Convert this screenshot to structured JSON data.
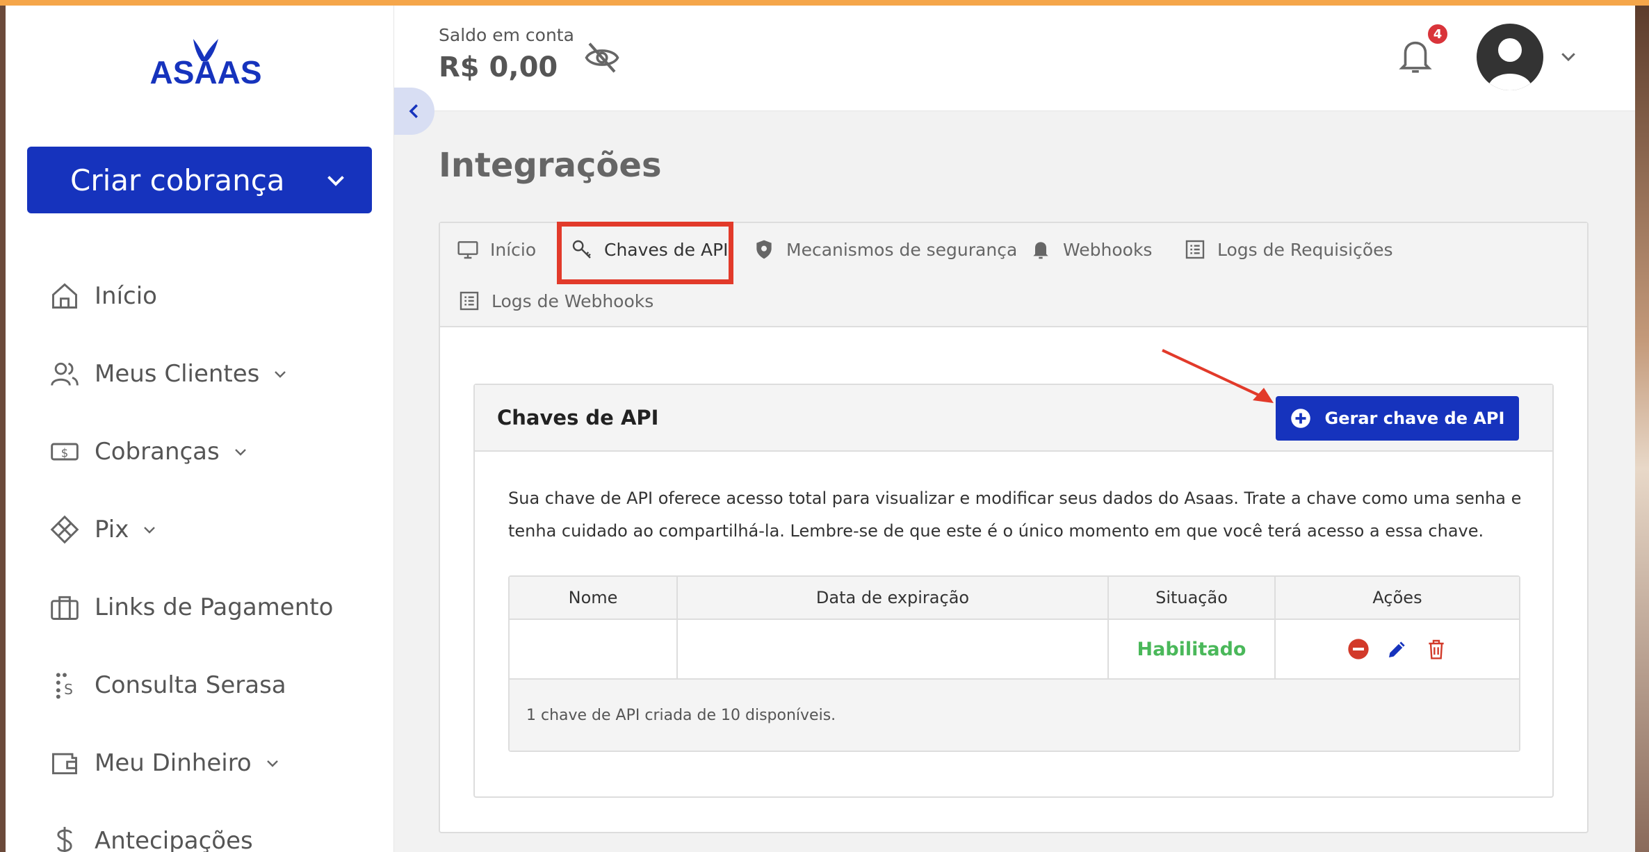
{
  "brand": {
    "logo_text": "ASAAS"
  },
  "sidebar": {
    "cta_label": "Criar cobrança",
    "items": [
      {
        "label": "Início",
        "icon": "home-icon",
        "has_caret": false
      },
      {
        "label": "Meus Clientes",
        "icon": "users-icon",
        "has_caret": true
      },
      {
        "label": "Cobranças",
        "icon": "money-icon",
        "has_caret": true
      },
      {
        "label": "Pix",
        "icon": "pix-icon",
        "has_caret": true
      },
      {
        "label": "Links de Pagamento",
        "icon": "briefcase-icon",
        "has_caret": false
      },
      {
        "label": "Consulta Serasa",
        "icon": "serasa-icon",
        "has_caret": false
      },
      {
        "label": "Meu Dinheiro",
        "icon": "wallet-icon",
        "has_caret": true
      },
      {
        "label": "Antecipações",
        "icon": "dollar-icon",
        "has_caret": false
      }
    ]
  },
  "header": {
    "balance_label": "Saldo em conta",
    "balance_value": "R$ 0,00",
    "notification_count": "4"
  },
  "page": {
    "title": "Integrações"
  },
  "tabs": [
    {
      "label": "Início",
      "icon": "monitor-icon"
    },
    {
      "label": "Chaves de API",
      "icon": "key-icon",
      "active": true
    },
    {
      "label": "Mecanismos de segurança",
      "icon": "shield-icon"
    },
    {
      "label": "Webhooks",
      "icon": "bell-icon"
    },
    {
      "label": "Logs de Requisições",
      "icon": "list-icon"
    },
    {
      "label": "Logs de Webhooks",
      "icon": "list-icon"
    }
  ],
  "card": {
    "title": "Chaves de API",
    "generate_button": "Gerar chave de API",
    "description": "Sua chave de API oferece acesso total para visualizar e modificar seus dados do Asaas. Trate a chave como uma senha e tenha cuidado ao compartilhá-la. Lembre-se de que este é o único momento em que você terá acesso a essa chave.",
    "table": {
      "columns": [
        "Nome",
        "Data de expiração",
        "Situação",
        "Ações"
      ],
      "rows": [
        {
          "name": "",
          "expiration": "",
          "status": "Habilitado"
        }
      ],
      "footer": "1 chave de API criada de 10 disponíveis."
    }
  },
  "colors": {
    "primary": "#1633bd",
    "accent_bar": "#f5a64a",
    "status_enabled": "#4ab85a",
    "highlight": "#e23a2a"
  }
}
